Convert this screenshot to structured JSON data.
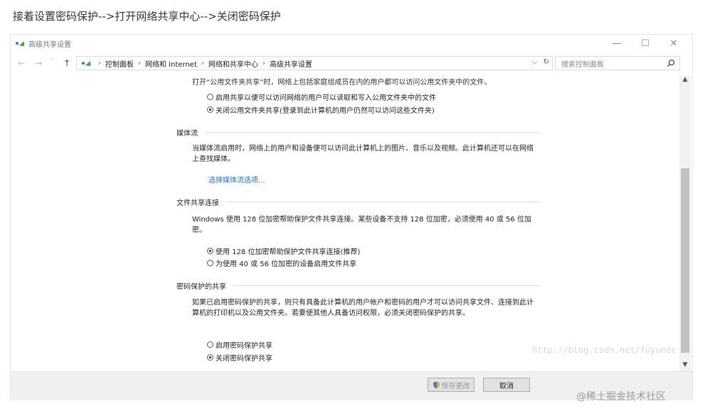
{
  "caption": "接着设置密码保护-->打开网络共享中心-->关闭密码保护",
  "window": {
    "title": "高级共享设置",
    "controls": [
      "—",
      "☐",
      "✕"
    ]
  },
  "navbar": {
    "back": "←",
    "forward": "→",
    "recent": "˅",
    "up": "↑",
    "breadcrumbs": [
      "控制面板",
      "网络和 Internet",
      "网络和共享中心",
      "高级共享设置"
    ],
    "dropdown": "⌵",
    "refresh": "↻",
    "search_placeholder": "搜索控制面板"
  },
  "content": {
    "cut_line": "打开“公用文件夹共享”时，网络上包括家庭组成员在内的用户都可以访问公用文件夹中的文件。",
    "public_folder": {
      "options": [
        {
          "label": "启用共享以便可以访问网络的用户可以读取和写入公用文件夹中的文件",
          "checked": false
        },
        {
          "label": "关闭公用文件夹共享(登录到此计算机的用户仍然可以访问这些文件夹)",
          "checked": true
        }
      ]
    },
    "media": {
      "heading": "媒体流",
      "description": "当媒体流启用时，网络上的用户和设备便可以访问此计算机上的图片、音乐以及视频。此计算机还可以在网络上查找媒体。",
      "link": "选择媒体流选项..."
    },
    "file_sharing": {
      "heading": "文件共享连接",
      "description": "Windows 使用 128 位加密帮助保护文件共享连接。某些设备不支持 128 位加密，必须使用 40 或 56 位加密。",
      "options": [
        {
          "label": "使用 128 位加密帮助保护文件共享连接(推荐)",
          "checked": true
        },
        {
          "label": "为使用 40 或 56 位加密的设备启用文件共享",
          "checked": false
        }
      ]
    },
    "password": {
      "heading": "密码保护的共享",
      "description": "如果已启用密码保护的共享，则只有具备此计算机的用户帐户和密码的用户才可以访问共享文件、连接到此计算机的打印机以及公用文件夹。若要使其他人具备访问权限，必须关闭密码保护的共享。",
      "options": [
        {
          "label": "启用密码保护共享",
          "checked": false
        },
        {
          "label": "关闭密码保护共享",
          "checked": true
        }
      ]
    }
  },
  "footer": {
    "save": "保存更改",
    "cancel": "取消"
  },
  "watermarks": {
    "blog": "http://blog.csdn.net/fuyunde",
    "site": "@稀土掘金技术社区"
  }
}
